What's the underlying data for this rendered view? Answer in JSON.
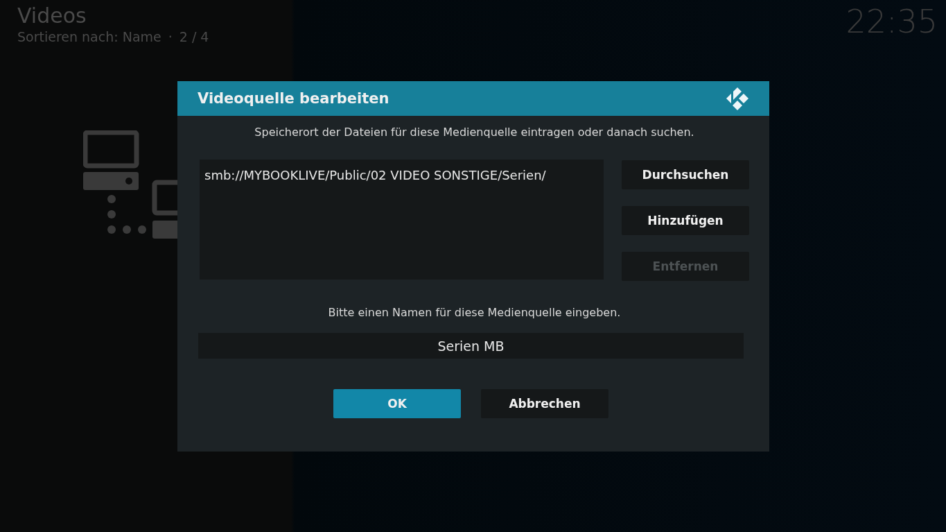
{
  "header": {
    "title": "Videos",
    "sort_info": "Sortieren nach: Name",
    "separator": "·",
    "count": "2 / 4",
    "clock": "22:35"
  },
  "dialog": {
    "title": "Videoquelle bearbeiten",
    "path_prompt": "Speicherort der Dateien für diese Medienquelle eintragen oder danach suchen.",
    "paths": [
      "smb://MYBOOKLIVE/Public/02 VIDEO SONSTIGE/Serien/"
    ],
    "side_buttons": [
      {
        "label": "Durchsuchen",
        "disabled": false
      },
      {
        "label": "Hinzufügen",
        "disabled": false
      },
      {
        "label": "Entfernen",
        "disabled": true
      }
    ],
    "name_prompt": "Bitte einen Namen für diese Medienquelle eingeben.",
    "name_value": "Serien MB",
    "buttons": [
      {
        "label": "OK",
        "selected": true
      },
      {
        "label": "Abbrechen",
        "selected": false
      }
    ]
  }
}
